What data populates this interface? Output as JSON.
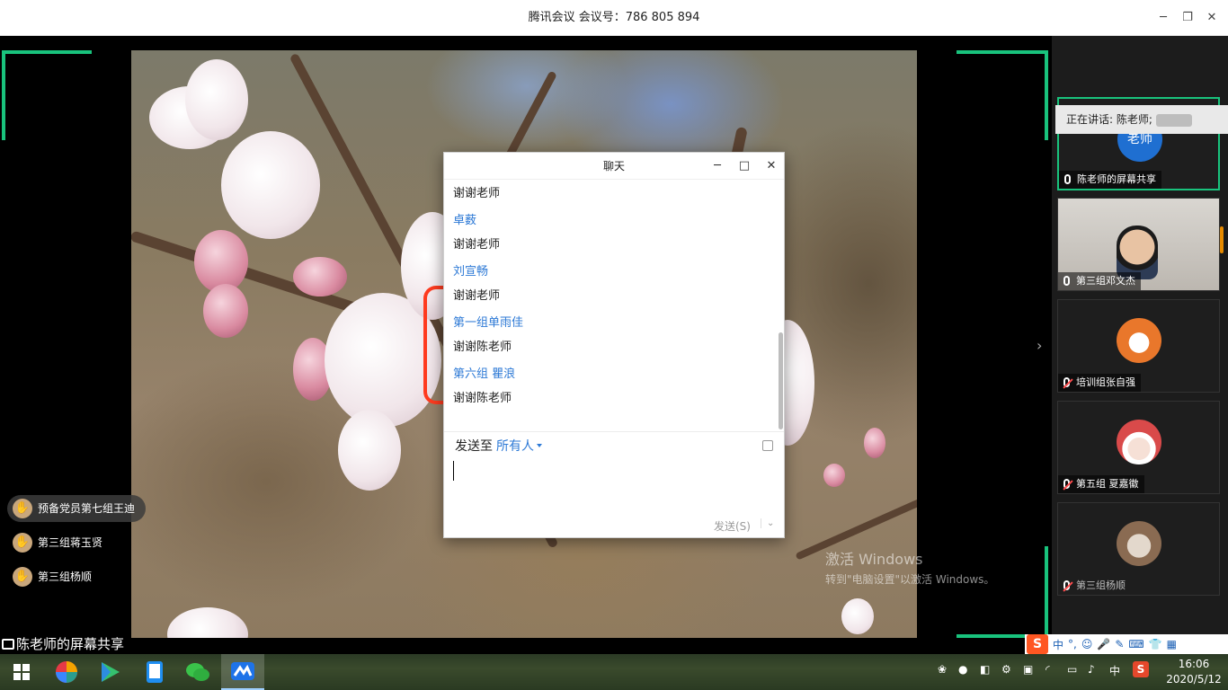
{
  "window": {
    "title": "腾讯会议 会议号：786 805 894",
    "minimize": "─",
    "maximize": "❐",
    "close": "✕"
  },
  "share": {
    "label": "陈老师的屏幕共享"
  },
  "raise_hands": [
    {
      "name": "预备党员第七组王迪"
    },
    {
      "name": "第三组蒋玉贤"
    },
    {
      "name": "第三组杨顺"
    }
  ],
  "watermark": {
    "line1": "激活 Windows",
    "line2": "转到\"电脑设置\"以激活 Windows。"
  },
  "participants": {
    "speaking_prefix": "正在讲话: 陈老师;",
    "tiles": [
      {
        "name": "陈老师的屏幕共享",
        "avatar_text": "老师"
      },
      {
        "name": "第三组邓文杰"
      },
      {
        "name": "培训组张自强"
      },
      {
        "name": "第五组 夏嘉徽"
      },
      {
        "name": "第三组杨顺"
      }
    ]
  },
  "chat": {
    "title": "聊天",
    "messages": [
      {
        "sender": "",
        "text": "谢谢老师"
      },
      {
        "sender": "卓薮",
        "text": "谢谢老师"
      },
      {
        "sender": "刘宣畅",
        "text": "谢谢老师"
      },
      {
        "sender": "第一组单雨佳",
        "text": "谢谢陈老师"
      },
      {
        "sender": "第六组 瞿浪",
        "text": "谢谢陈老师"
      }
    ],
    "send_to_label": "发送至",
    "recipient": "所有人",
    "send_button": "发送(S)",
    "send_menu": "⌄"
  },
  "ime": {
    "logo": "S",
    "lang": "中",
    "punct": "°,",
    "emoji": "☺",
    "mic": "🎤",
    "pen": "✎",
    "keyboard": "⌨",
    "skin": "👕",
    "tools": "▦"
  },
  "taskbar": {
    "time": "16:06",
    "date": "2020/5/12",
    "lang": "中"
  },
  "colors": {
    "accent_green": "#19c37d",
    "link_blue": "#2e7ad6",
    "annotation_red": "#ff3b1f"
  }
}
